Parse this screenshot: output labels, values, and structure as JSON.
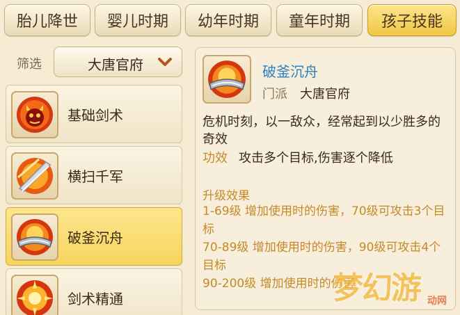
{
  "tabs": [
    {
      "label": "胎儿降世",
      "active": false
    },
    {
      "label": "婴儿时期",
      "active": false
    },
    {
      "label": "幼年时期",
      "active": false
    },
    {
      "label": "童年时期",
      "active": false
    },
    {
      "label": "孩子技能",
      "active": true
    }
  ],
  "filter": {
    "label": "筛选",
    "selected": "大唐官府"
  },
  "skills": [
    {
      "name": "基础剑术",
      "icon": "red-demon-face-icon",
      "selected": false
    },
    {
      "name": "横扫千军",
      "icon": "sword-slash-icon",
      "selected": false
    },
    {
      "name": "破釜沉舟",
      "icon": "flaming-blade-icon",
      "selected": true
    },
    {
      "name": "剑术精通",
      "icon": "flame-burst-icon",
      "selected": false
    }
  ],
  "detail": {
    "title": "破釜沉舟",
    "icon": "flaming-blade-icon",
    "school_label": "门派",
    "school_value": "大唐官府",
    "description": "危机时刻，以一敌众，经常起到以少胜多的奇效",
    "effect_label": "功效",
    "effect_text": "攻击多个目标,伤害逐个降低",
    "upgrade_title": "升级效果",
    "upgrade_lines": [
      "1-69级 增加使用时的伤害，70级可攻击3个目标",
      "70-89级 增加使用时的伤害，90级可攻击4个目标",
      "90-200级 增加使用时的伤害"
    ]
  },
  "watermark": {
    "main": "梦幻游",
    "sub": "动网"
  },
  "colors": {
    "accent_gold": "#f0c646",
    "title_blue": "#2f7fc2",
    "upgrade_orange": "#c48a2a"
  }
}
